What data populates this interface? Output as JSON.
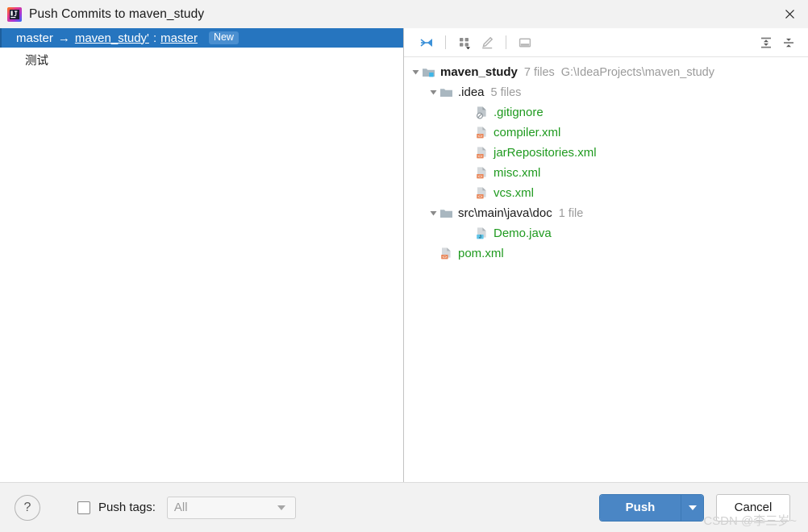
{
  "window": {
    "title": "Push Commits to maven_study",
    "app_icon": "intellij-idea-icon",
    "close_icon": "close-icon"
  },
  "commits": {
    "selected_row": {
      "source_branch": "master",
      "arrow": "→",
      "remote": "maven_study'",
      "separator": ":",
      "target_branch": "master",
      "badge": "New"
    },
    "message": "测试"
  },
  "toolbar": {
    "buttons": [
      {
        "name": "collapse-selection-icon",
        "title": "Collapse Selection"
      },
      {
        "name": "group-by-icon",
        "title": "Group By"
      },
      {
        "name": "edit-icon",
        "title": "Edit Source"
      },
      {
        "name": "preview-icon",
        "title": "Preview Diff"
      }
    ],
    "right_buttons": [
      {
        "name": "expand-all-icon",
        "title": "Expand All"
      },
      {
        "name": "collapse-all-icon",
        "title": "Collapse All"
      }
    ]
  },
  "tree": {
    "nodes": [
      {
        "label": "maven_study",
        "count": "7 files",
        "path": "G:\\IdeaProjects\\maven_study",
        "icon": "module-folder-icon",
        "twisty": "expanded",
        "indent": 0,
        "color": "default",
        "bold": true
      },
      {
        "label": ".idea",
        "count": "5 files",
        "path": "",
        "icon": "folder-icon",
        "twisty": "expanded",
        "indent": 1,
        "color": "default",
        "bold": false
      },
      {
        "label": ".gitignore",
        "count": "",
        "path": "",
        "icon": "gitignore-file-icon",
        "twisty": "none",
        "indent": 3,
        "color": "green",
        "bold": false
      },
      {
        "label": "compiler.xml",
        "count": "",
        "path": "",
        "icon": "xml-file-icon",
        "twisty": "none",
        "indent": 3,
        "color": "green",
        "bold": false
      },
      {
        "label": "jarRepositories.xml",
        "count": "",
        "path": "",
        "icon": "xml-file-icon",
        "twisty": "none",
        "indent": 3,
        "color": "green",
        "bold": false
      },
      {
        "label": "misc.xml",
        "count": "",
        "path": "",
        "icon": "xml-file-icon",
        "twisty": "none",
        "indent": 3,
        "color": "green",
        "bold": false
      },
      {
        "label": "vcs.xml",
        "count": "",
        "path": "",
        "icon": "xml-file-icon",
        "twisty": "none",
        "indent": 3,
        "color": "green",
        "bold": false
      },
      {
        "label": "src\\main\\java\\doc",
        "count": "1 file",
        "path": "",
        "icon": "folder-icon",
        "twisty": "expanded",
        "indent": 1,
        "color": "default",
        "bold": false
      },
      {
        "label": "Demo.java",
        "count": "",
        "path": "",
        "icon": "java-file-icon",
        "twisty": "none",
        "indent": 3,
        "color": "green",
        "bold": false
      },
      {
        "label": "pom.xml",
        "count": "",
        "path": "",
        "icon": "xml-file-icon",
        "twisty": "none",
        "indent": 1,
        "color": "green",
        "bold": false
      }
    ]
  },
  "bottom": {
    "help_label": "?",
    "push_tags_label": "Push tags:",
    "push_tags_checked": false,
    "tags_value": "All",
    "push_label": "Push",
    "cancel_label": "Cancel"
  },
  "watermark": "CSDN @李三岁~",
  "colors": {
    "selection_blue": "#2675bf",
    "badge_blue": "#4a8fd0",
    "new_file_green": "#1f9a1f",
    "push_button_blue": "#4a86c5",
    "xml_badge_orange": "#e8875a",
    "java_badge_blue": "#5fc4e8",
    "dialog_bg": "#f2f2f2"
  }
}
